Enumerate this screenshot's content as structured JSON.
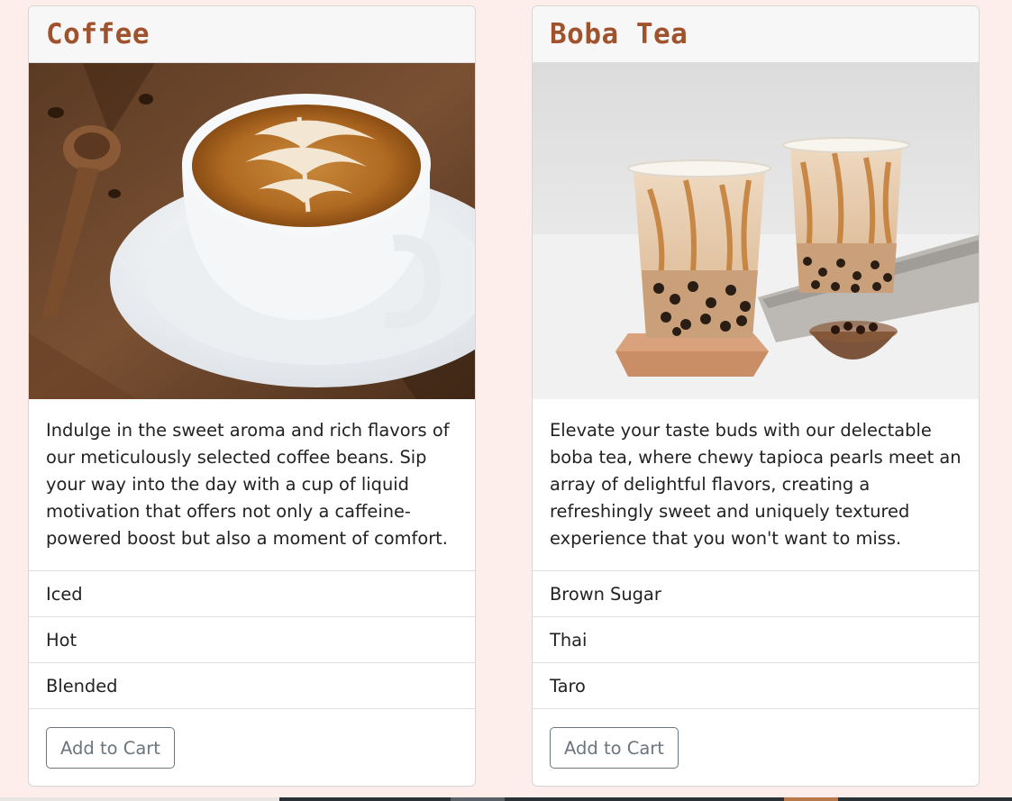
{
  "cards": [
    {
      "title": "Coffee",
      "image_subject": "latte art coffee cup on saucer",
      "description": "Indulge in the sweet aroma and rich flavors of our meticulously selected coffee beans. Sip your way into the day with a cup of liquid motivation that offers not only a caffeine-powered boost but also a moment of comfort.",
      "options": [
        "Iced",
        "Hot",
        "Blended"
      ],
      "button_label": "Add to Cart"
    },
    {
      "title": "Boba Tea",
      "image_subject": "two cups of brown sugar boba milk tea",
      "description": "Elevate your taste buds with our delectable boba tea, where chewy tapioca pearls meet an array of delightful flavors, creating a refreshingly sweet and uniquely textured experience that you won't want to miss.",
      "options": [
        "Brown Sugar",
        "Thai",
        "Taro"
      ],
      "button_label": "Add to Cart"
    }
  ],
  "colors": {
    "page_background": "#fdeeec",
    "title_color": "#a0522d",
    "button_outline": "#6c757d"
  }
}
